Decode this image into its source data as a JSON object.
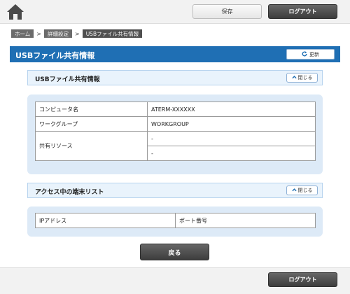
{
  "header": {
    "save_label": "保存",
    "logout_label": "ログアウト"
  },
  "breadcrumb": {
    "items": [
      "ホーム",
      "詳細設定",
      "USBファイル共有情報"
    ],
    "separator": ">"
  },
  "page": {
    "title": "USBファイル共有情報",
    "refresh_label": "更新"
  },
  "usb_section": {
    "title": "USBファイル共有情報",
    "close_label": "閉じる",
    "rows": {
      "computer_name": {
        "label": "コンピュータ名",
        "value": "ATERM-XXXXXX"
      },
      "workgroup": {
        "label": "ワークグループ",
        "value": "WORKGROUP"
      },
      "shared_resource": {
        "label": "共有リソース",
        "values": [
          "-",
          "-"
        ]
      }
    }
  },
  "terminal_section": {
    "title": "アクセス中の端末リスト",
    "close_label": "閉じる",
    "columns": [
      "IPアドレス",
      "ポート番号"
    ]
  },
  "back_label": "戻る",
  "footer": {
    "logout_label": "ログアウト"
  },
  "colors": {
    "header_blue": "#1f6fb4",
    "section_bg": "#ddeaf7",
    "dark_button": "#4a4a4a"
  }
}
